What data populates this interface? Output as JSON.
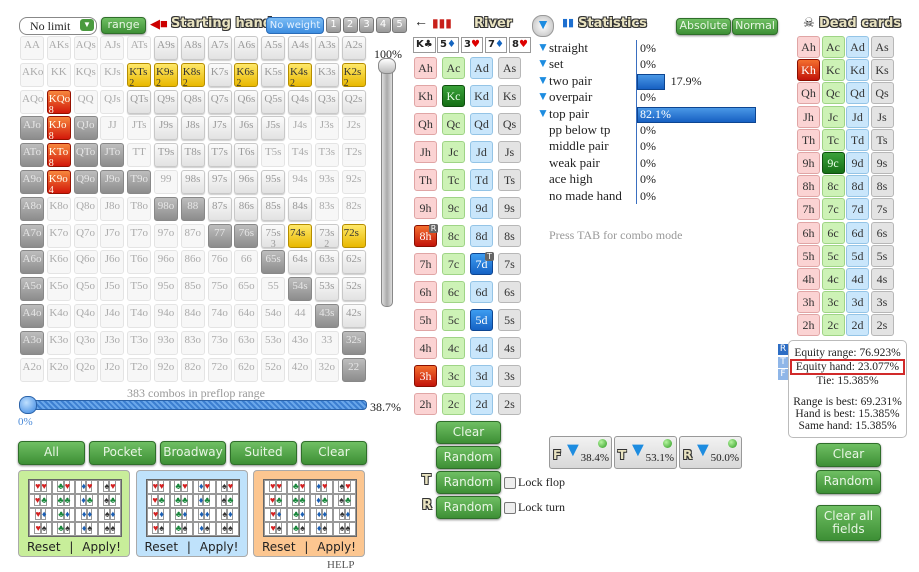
{
  "top": {
    "mode_select": "No limit",
    "range_btn": "range",
    "starting_hand": "Starting hand",
    "no_weight": "No weight",
    "weights": [
      "1",
      "2",
      "3",
      "4",
      "5"
    ],
    "river": "River"
  },
  "board": [
    {
      "r": "K",
      "s": "♣",
      "c": "#222"
    },
    {
      "r": "5",
      "s": "♦",
      "c": "#1565c0"
    },
    {
      "r": "3",
      "s": "♥",
      "c": "#d00"
    },
    {
      "r": "7",
      "s": "♦",
      "c": "#1565c0"
    },
    {
      "r": "8",
      "s": "♥",
      "c": "#d00"
    }
  ],
  "grid": {
    "labels": [
      [
        "AA",
        "AKs",
        "AQs",
        "AJs",
        "ATs",
        "A9s",
        "A8s",
        "A7s",
        "A6s",
        "A5s",
        "A4s",
        "A3s",
        "A2s"
      ],
      [
        "AKo",
        "KK",
        "KQs",
        "KJs",
        "KTs",
        "K9s",
        "K8s",
        "K7s",
        "K6s",
        "K5s",
        "K4s",
        "K3s",
        "K2s"
      ],
      [
        "AQo",
        "KQo",
        "QQ",
        "QJs",
        "QTs",
        "Q9s",
        "Q8s",
        "Q7s",
        "Q6s",
        "Q5s",
        "Q4s",
        "Q3s",
        "Q2s"
      ],
      [
        "AJo",
        "KJo",
        "QJo",
        "JJ",
        "JTs",
        "J9s",
        "J8s",
        "J7s",
        "J6s",
        "J5s",
        "J4s",
        "J3s",
        "J2s"
      ],
      [
        "ATo",
        "KTo",
        "QTo",
        "JTo",
        "TT",
        "T9s",
        "T8s",
        "T7s",
        "T6s",
        "T5s",
        "T4s",
        "T3s",
        "T2s"
      ],
      [
        "A9o",
        "K9o",
        "Q9o",
        "J9o",
        "T9o",
        "99",
        "98s",
        "97s",
        "96s",
        "95s",
        "94s",
        "93s",
        "92s"
      ],
      [
        "A8o",
        "K8o",
        "Q8o",
        "J8o",
        "T8o",
        "98o",
        "88",
        "87s",
        "86s",
        "85s",
        "84s",
        "83s",
        "82s"
      ],
      [
        "A7o",
        "K7o",
        "Q7o",
        "J7o",
        "T7o",
        "97o",
        "87o",
        "77",
        "76s",
        "75s",
        "74s",
        "73s",
        "72s"
      ],
      [
        "A6o",
        "K6o",
        "Q6o",
        "J6o",
        "T6o",
        "96o",
        "86o",
        "76o",
        "66",
        "65s",
        "64s",
        "63s",
        "62s"
      ],
      [
        "A5o",
        "K5o",
        "Q5o",
        "J5o",
        "T5o",
        "95o",
        "85o",
        "75o",
        "65o",
        "55",
        "54s",
        "53s",
        "52s"
      ],
      [
        "A4o",
        "K4o",
        "Q4o",
        "J4o",
        "T4o",
        "94o",
        "84o",
        "74o",
        "64o",
        "54o",
        "44",
        "43s",
        "42s"
      ],
      [
        "A3o",
        "K3o",
        "Q3o",
        "J3o",
        "T3o",
        "93o",
        "83o",
        "73o",
        "63o",
        "53o",
        "43o",
        "33",
        "32s"
      ],
      [
        "A2o",
        "K2o",
        "Q2o",
        "J2o",
        "T2o",
        "92o",
        "82o",
        "72o",
        "62o",
        "52o",
        "42o",
        "32o",
        "22"
      ]
    ],
    "states": [
      "fffffnnnnnnnn",
      "ffffyyynynyny",
      "frffnnnnnnnnn",
      "drdffnnnnnfff",
      "drddfnnnnffff",
      "drdddfnnnnfff",
      "dffffddnnnnff",
      "dffffffddnyny",
      "dffffffffdnnnf",
      "dfffffffffdnn",
      "dffffffffffdnn",
      "dfffffffffffdn",
      "ffffffffffffd"
    ],
    "weights": {
      "KTs": "2",
      "K9s": "2",
      "K8s": "2",
      "K6s": "2",
      "K4s": "2",
      "K2s": "2",
      "KQo": "8",
      "KJo": "8",
      "KTo": "8",
      "K9o": "4",
      "75s": "3",
      "73s": "2"
    }
  },
  "vslider": {
    "label": "100%",
    "value": 100
  },
  "combos": "383 combos in preflop range",
  "hslider": {
    "label": "38.7%",
    "value": 38.7,
    "min_label": "0%"
  },
  "range_buttons": [
    "All",
    "Pocket",
    "Broadway",
    "Suited",
    "Clear"
  ],
  "suit_boxes": {
    "suits": [
      {
        "s": "♥",
        "c": "#d42020"
      },
      {
        "s": "♣",
        "c": "#17863a"
      },
      {
        "s": "♦",
        "c": "#1a5fb4"
      },
      {
        "s": "♠",
        "c": "#333"
      }
    ],
    "reset": "Reset",
    "sep": "|",
    "apply": "Apply!",
    "colors": [
      "#c8ee9a",
      "#bfe2fb",
      "#fcc690"
    ]
  },
  "help": "HELP",
  "cards": {
    "ranks": [
      "A",
      "K",
      "Q",
      "J",
      "T",
      "9",
      "8",
      "7",
      "6",
      "5",
      "4",
      "3",
      "2"
    ],
    "suits": [
      "h",
      "c",
      "d",
      "s"
    ]
  },
  "board_picker": {
    "selected": {
      "Kc": "",
      "8h": "R",
      "7d": "T",
      "5d": "",
      "3h": ""
    },
    "clear": "Clear",
    "random": "Random",
    "turn_label": "T",
    "river_label": "R",
    "random_turn": "Random",
    "random_river": "Random",
    "lock_flop": "Lock flop",
    "lock_turn": "Lock turn"
  },
  "stats": {
    "title": "Statistics",
    "absolute": "Absolute",
    "normal": "Normal",
    "hint": "Press TAB for combo mode",
    "rows": [
      {
        "label": "straight",
        "pct": 0,
        "text": "0%",
        "filter": true
      },
      {
        "label": "set",
        "pct": 0,
        "text": "0%",
        "filter": true
      },
      {
        "label": "two pair",
        "pct": 17.9,
        "text": "17.9%",
        "filter": true
      },
      {
        "label": "overpair",
        "pct": 0,
        "text": "0%",
        "filter": true
      },
      {
        "label": "top pair",
        "pct": 82.1,
        "text": "82.1%",
        "filter": true
      },
      {
        "label": "pp below tp",
        "pct": 0,
        "text": "0%",
        "filter": false
      },
      {
        "label": "middle pair",
        "pct": 0,
        "text": "0%",
        "filter": false
      },
      {
        "label": "weak pair",
        "pct": 0,
        "text": "0%",
        "filter": false
      },
      {
        "label": "ace high",
        "pct": 0,
        "text": "0%",
        "filter": false
      },
      {
        "label": "no made hand",
        "pct": 0,
        "text": "0%",
        "filter": false
      }
    ],
    "filters": [
      {
        "street": "F",
        "value": "38.4%"
      },
      {
        "street": "T",
        "value": "53.1%"
      },
      {
        "street": "R",
        "value": "50.0%"
      }
    ]
  },
  "dead": {
    "title": "Dead cards",
    "selected": [
      "Kh",
      "9c"
    ],
    "clear": "Clear",
    "random": "Random",
    "clear_all": "Clear all fields"
  },
  "equity": {
    "tabs": [
      "R",
      "T",
      "F"
    ],
    "equity_range": "Equity range: 76.923%",
    "equity_hand": "Equity hand: 23.077%",
    "tie": "Tie: 15.385%",
    "range_best": "Range is best: 69.231%",
    "hand_best": "Hand is best: 15.385%",
    "same_hand": "Same hand: 15.385%"
  }
}
